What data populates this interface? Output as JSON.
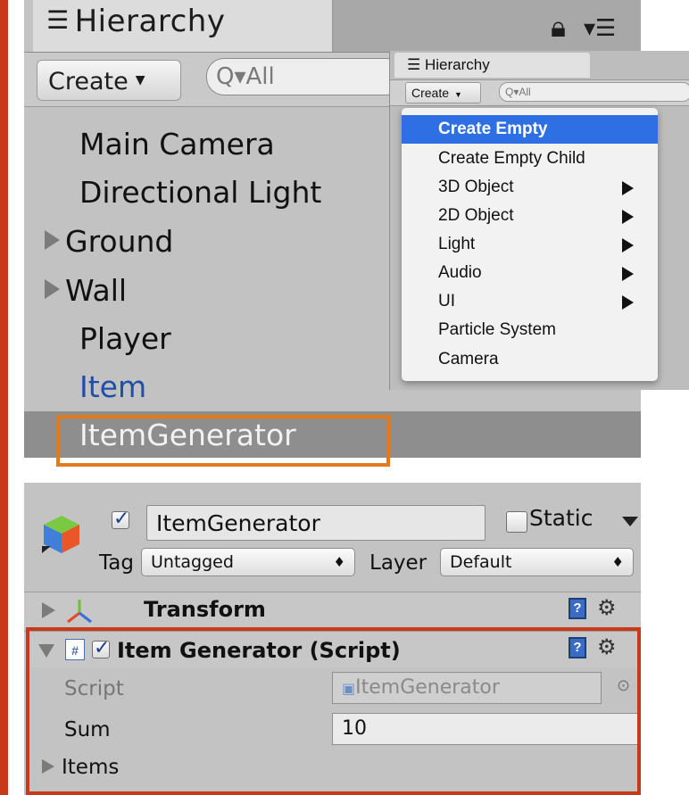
{
  "hierarchy": {
    "title": "Hierarchy",
    "create_label": "Create",
    "search_placeholder": "All",
    "items": [
      {
        "label": "Main Camera",
        "has_children": false
      },
      {
        "label": "Directional Light",
        "has_children": false
      },
      {
        "label": "Ground",
        "has_children": true
      },
      {
        "label": "Wall",
        "has_children": true
      },
      {
        "label": "Player",
        "has_children": false
      },
      {
        "label": "Item",
        "has_children": false,
        "color": "#1f4fa8"
      },
      {
        "label": "ItemGenerator",
        "has_children": false,
        "selected": true,
        "color": "#f2f2f2"
      }
    ],
    "highlight_color": "#e07a1a"
  },
  "overlay_hierarchy": {
    "title": "Hierarchy",
    "create_label": "Create",
    "search_placeholder": "All"
  },
  "create_menu": {
    "items": [
      {
        "label": "Create Empty",
        "submenu": false,
        "active": true
      },
      {
        "label": "Create Empty Child",
        "submenu": false
      },
      {
        "label": "3D Object",
        "submenu": true
      },
      {
        "label": "2D Object",
        "submenu": true
      },
      {
        "label": "Light",
        "submenu": true
      },
      {
        "label": "Audio",
        "submenu": true
      },
      {
        "label": "UI",
        "submenu": true
      },
      {
        "label": "Particle System",
        "submenu": false
      },
      {
        "label": "Camera",
        "submenu": false
      }
    ],
    "active_color": "#2f6fe4"
  },
  "inspector": {
    "object_name": "ItemGenerator",
    "active_checked": true,
    "static_label": "Static",
    "static_checked": false,
    "tag_label": "Tag",
    "tag_value": "Untagged",
    "layer_label": "Layer",
    "layer_value": "Default",
    "transform": {
      "title": "Transform",
      "expanded": false
    },
    "script_component": {
      "title": "Item Generator (Script)",
      "enabled": true,
      "expanded": true,
      "fields": [
        {
          "label": "Script",
          "value": "ItemGenerator",
          "disabled": true
        },
        {
          "label": "Sum",
          "value": "10"
        }
      ],
      "items_label": "Items"
    },
    "highlight_color": "#c8381a"
  }
}
